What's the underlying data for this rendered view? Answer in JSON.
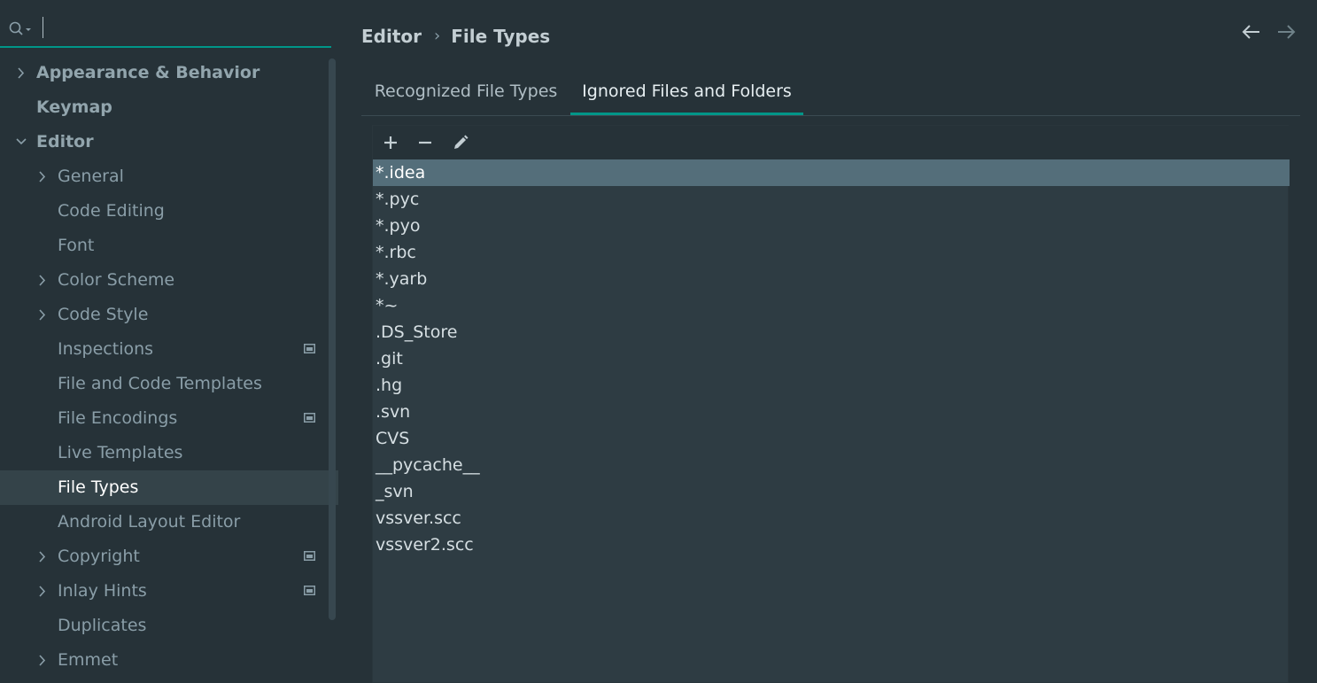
{
  "search": {
    "placeholder": ""
  },
  "sidebar": {
    "items": [
      {
        "label": "Appearance & Behavior",
        "level": 0,
        "arrow": "right",
        "bold": true,
        "proj": false,
        "selected": false
      },
      {
        "label": "Keymap",
        "level": 0,
        "arrow": "none",
        "bold": true,
        "proj": false,
        "selected": false
      },
      {
        "label": "Editor",
        "level": 0,
        "arrow": "down",
        "bold": true,
        "proj": false,
        "selected": false
      },
      {
        "label": "General",
        "level": 1,
        "arrow": "right",
        "bold": false,
        "proj": false,
        "selected": false
      },
      {
        "label": "Code Editing",
        "level": 1,
        "arrow": "none",
        "bold": false,
        "proj": false,
        "selected": false
      },
      {
        "label": "Font",
        "level": 1,
        "arrow": "none",
        "bold": false,
        "proj": false,
        "selected": false
      },
      {
        "label": "Color Scheme",
        "level": 1,
        "arrow": "right",
        "bold": false,
        "proj": false,
        "selected": false
      },
      {
        "label": "Code Style",
        "level": 1,
        "arrow": "right",
        "bold": false,
        "proj": false,
        "selected": false
      },
      {
        "label": "Inspections",
        "level": 1,
        "arrow": "none",
        "bold": false,
        "proj": true,
        "selected": false
      },
      {
        "label": "File and Code Templates",
        "level": 1,
        "arrow": "none",
        "bold": false,
        "proj": false,
        "selected": false
      },
      {
        "label": "File Encodings",
        "level": 1,
        "arrow": "none",
        "bold": false,
        "proj": true,
        "selected": false
      },
      {
        "label": "Live Templates",
        "level": 1,
        "arrow": "none",
        "bold": false,
        "proj": false,
        "selected": false
      },
      {
        "label": "File Types",
        "level": 1,
        "arrow": "none",
        "bold": false,
        "proj": false,
        "selected": true
      },
      {
        "label": "Android Layout Editor",
        "level": 1,
        "arrow": "none",
        "bold": false,
        "proj": false,
        "selected": false
      },
      {
        "label": "Copyright",
        "level": 1,
        "arrow": "right",
        "bold": false,
        "proj": true,
        "selected": false
      },
      {
        "label": "Inlay Hints",
        "level": 1,
        "arrow": "right",
        "bold": false,
        "proj": true,
        "selected": false
      },
      {
        "label": "Duplicates",
        "level": 1,
        "arrow": "none",
        "bold": false,
        "proj": false,
        "selected": false
      },
      {
        "label": "Emmet",
        "level": 1,
        "arrow": "right",
        "bold": false,
        "proj": false,
        "selected": false
      }
    ]
  },
  "breadcrumb": {
    "parent": "Editor",
    "separator": "›",
    "current": "File Types"
  },
  "tabs": [
    {
      "label": "Recognized File Types",
      "active": false
    },
    {
      "label": "Ignored Files and Folders",
      "active": true
    }
  ],
  "ignored_list": [
    "*.idea",
    "*.pyc",
    "*.pyo",
    "*.rbc",
    "*.yarb",
    "*~",
    ".DS_Store",
    ".git",
    ".hg",
    ".svn",
    "CVS",
    "__pycache__",
    "_svn",
    "vssver.scc",
    "vssver2.scc"
  ],
  "selected_index": 0,
  "icons": {
    "search": "search-icon",
    "add": "add-icon",
    "remove": "remove-icon",
    "edit": "edit-icon",
    "back": "arrow-left-icon",
    "forward": "arrow-right-icon",
    "project": "project-level-icon"
  },
  "colors": {
    "accent": "#009688",
    "background": "#263238",
    "selection": "#546e7a"
  }
}
